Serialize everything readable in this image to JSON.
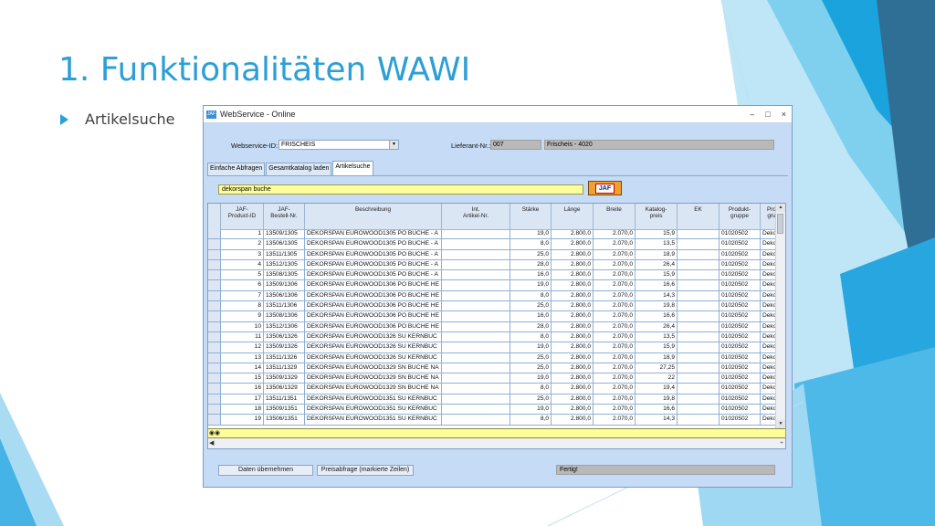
{
  "slide": {
    "title": "1. Funktionalitäten WAWI",
    "bullet": "Artikelsuche"
  },
  "window": {
    "title": "WebService - Online",
    "icon_text": "JAF",
    "controls": [
      "–",
      "□",
      "×"
    ]
  },
  "form": {
    "webservice_label": "Webservice-ID:",
    "webservice_value": "FRISCHEIS",
    "lieferant_label": "Lieferant-Nr.:",
    "lieferant_nr": "007",
    "lieferant_name": "Frischeis - 4020"
  },
  "tabs": [
    "Einfache Abfragen",
    "Gesamtkatalog laden",
    "Artikelsuche"
  ],
  "search": {
    "value": "dekorspan buche",
    "button_label": "JAF"
  },
  "table": {
    "columns": [
      "",
      "JAF-\nProduct-ID",
      "JAF-\nBestell-Nr.",
      "Beschreibung",
      "Int.\nArtikel-Nr.",
      "Stärke",
      "Länge",
      "Breite",
      "Katalog-\npreis",
      "EK",
      "Produkt-\ngruppe",
      "Pro\ngru"
    ],
    "rows": [
      [
        "1",
        "13509/1305",
        "DEKORSPAN EUROWOOD1305 PO BUCHE - A",
        "",
        "19,0",
        "2.800,0",
        "2.070,0",
        "15,9",
        "",
        "01020502",
        "Dekor"
      ],
      [
        "2",
        "13506/1305",
        "DEKORSPAN EUROWOOD1305 PO BUCHE - A",
        "",
        "8,0",
        "2.800,0",
        "2.070,0",
        "13,5",
        "",
        "01020502",
        "Dekor"
      ],
      [
        "3",
        "13511/1305",
        "DEKORSPAN EUROWOOD1305 PO BUCHE - A",
        "",
        "25,0",
        "2.800,0",
        "2.070,0",
        "18,9",
        "",
        "01020502",
        "Dekor"
      ],
      [
        "4",
        "13512/1305",
        "DEKORSPAN EUROWOOD1305 PO BUCHE - A",
        "",
        "28,0",
        "2.800,0",
        "2.070,0",
        "26,4",
        "",
        "01020502",
        "Dekor"
      ],
      [
        "5",
        "13508/1305",
        "DEKORSPAN EUROWOOD1305 PO BUCHE - A",
        "",
        "16,0",
        "2.800,0",
        "2.070,0",
        "15,9",
        "",
        "01020502",
        "Dekor"
      ],
      [
        "6",
        "13509/1306",
        "DEKORSPAN EUROWOOD1306 PO BUCHE HE",
        "",
        "19,0",
        "2.800,0",
        "2.070,0",
        "16,6",
        "",
        "01020502",
        "Dekor"
      ],
      [
        "7",
        "13506/1306",
        "DEKORSPAN EUROWOOD1306 PO BUCHE HE",
        "",
        "8,0",
        "2.800,0",
        "2.070,0",
        "14,3",
        "",
        "01020502",
        "Dekor"
      ],
      [
        "8",
        "13511/1306",
        "DEKORSPAN EUROWOOD1306 PO BUCHE HE",
        "",
        "25,0",
        "2.800,0",
        "2.070,0",
        "19,8",
        "",
        "01020502",
        "Dekor"
      ],
      [
        "9",
        "13508/1306",
        "DEKORSPAN EUROWOOD1306 PO BUCHE HE",
        "",
        "16,0",
        "2.800,0",
        "2.070,0",
        "16,6",
        "",
        "01020502",
        "Dekor"
      ],
      [
        "10",
        "13512/1306",
        "DEKORSPAN EUROWOOD1306 PO BUCHE HE",
        "",
        "28,0",
        "2.800,0",
        "2.070,0",
        "26,4",
        "",
        "01020502",
        "Dekor"
      ],
      [
        "11",
        "13506/1326",
        "DEKORSPAN EUROWOOD1326 SU KERNBUC",
        "",
        "8,0",
        "2.800,0",
        "2.070,0",
        "13,5",
        "",
        "01020502",
        "Dekor"
      ],
      [
        "12",
        "13509/1326",
        "DEKORSPAN EUROWOOD1326 SU KERNBUC",
        "",
        "19,0",
        "2.800,0",
        "2.070,0",
        "15,9",
        "",
        "01020502",
        "Dekor"
      ],
      [
        "13",
        "13511/1326",
        "DEKORSPAN EUROWOOD1326 SU KERNBUC",
        "",
        "25,0",
        "2.800,0",
        "2.070,0",
        "18,9",
        "",
        "01020502",
        "Dekor"
      ],
      [
        "14",
        "13511/1329",
        "DEKORSPAN EUROWOOD1329 SN BUCHE NA",
        "",
        "25,0",
        "2.800,0",
        "2.070,0",
        "27,25",
        "",
        "01020502",
        "Dekor"
      ],
      [
        "15",
        "13509/1329",
        "DEKORSPAN EUROWOOD1329 SN BUCHE NA",
        "",
        "19,0",
        "2.800,0",
        "2.070,0",
        "22",
        "",
        "01020502",
        "Dekor"
      ],
      [
        "16",
        "13506/1329",
        "DEKORSPAN EUROWOOD1329 SN BUCHE NA",
        "",
        "8,0",
        "2.800,0",
        "2.070,0",
        "19,4",
        "",
        "01020502",
        "Dekor"
      ],
      [
        "17",
        "13511/1351",
        "DEKORSPAN EUROWOOD1351 SU KERNBUC",
        "",
        "25,0",
        "2.800,0",
        "2.070,0",
        "19,8",
        "",
        "01020502",
        "Dekor"
      ],
      [
        "18",
        "13509/1351",
        "DEKORSPAN EUROWOOD1351 SU KERNBUC",
        "",
        "19,0",
        "2.800,0",
        "2.070,0",
        "16,6",
        "",
        "01020502",
        "Dekor"
      ],
      [
        "19",
        "13506/1351",
        "DEKORSPAN EUROWOOD1351 SU KERNBUC",
        "",
        "8,0",
        "2.800,0",
        "2.070,0",
        "14,3",
        "",
        "01020502",
        "Dekor"
      ]
    ]
  },
  "buttons": {
    "take_data": "Daten übernehmen",
    "price_request": "Preisabfrage (markierte Zeilen)"
  },
  "status": "Fertig!",
  "colors": {
    "accent": "#2b9fd6",
    "search_bg": "#ffff99",
    "window_bg": "#c6dbf5",
    "jaf_button": "#f0a030"
  }
}
